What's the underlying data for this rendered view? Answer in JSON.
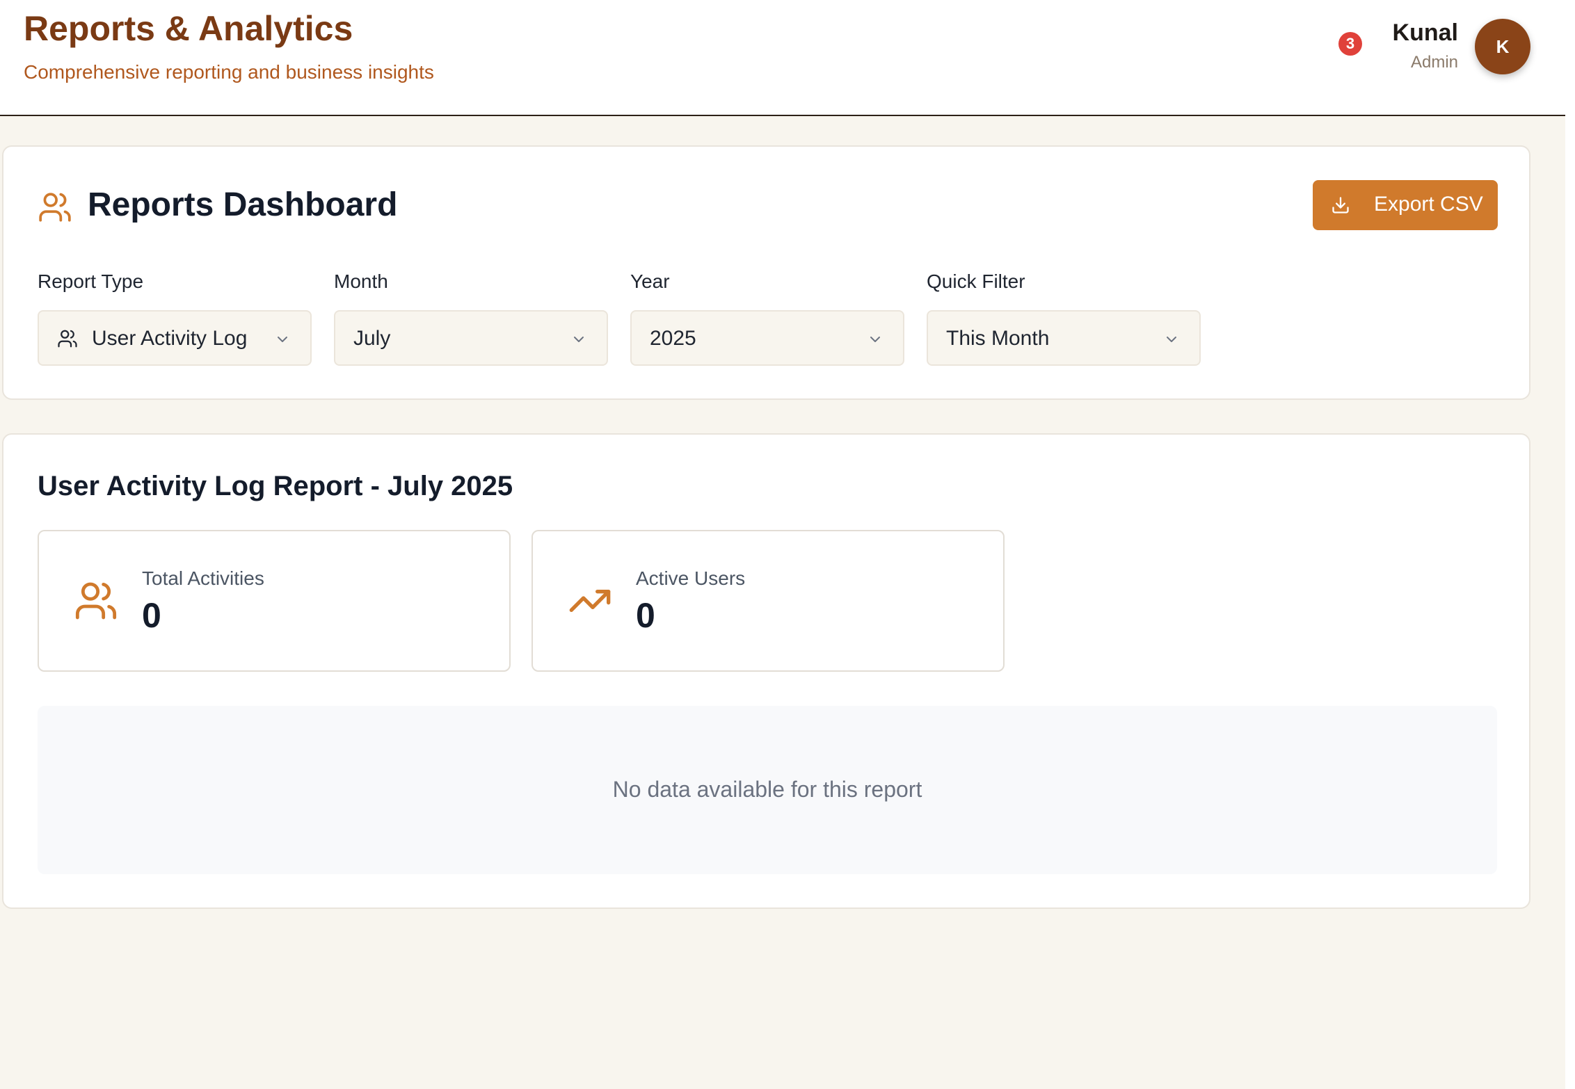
{
  "header": {
    "title": "Reports & Analytics",
    "subtitle": "Comprehensive reporting and business insights",
    "notification_count": "3",
    "user": {
      "name": "Kunal",
      "role": "Admin",
      "initial": "K"
    }
  },
  "dashboard": {
    "title": "Reports Dashboard",
    "icon": "users-icon",
    "export_label": "Export CSV",
    "filters": [
      {
        "label": "Report Type",
        "value": "User Activity Log",
        "icon": "users-icon"
      },
      {
        "label": "Month",
        "value": "July"
      },
      {
        "label": "Year",
        "value": "2025"
      },
      {
        "label": "Quick Filter",
        "value": "This Month"
      }
    ]
  },
  "report": {
    "title": "User Activity Log Report - July 2025",
    "stats": [
      {
        "label": "Total Activities",
        "value": "0",
        "icon": "users-icon"
      },
      {
        "label": "Active Users",
        "value": "0",
        "icon": "trending-up-icon"
      }
    ],
    "empty_message": "No data available for this report"
  },
  "colors": {
    "accent": "#d07a2c",
    "brand_dark": "#7a3a14",
    "background": "#f8f5ee",
    "badge": "#e0413a"
  }
}
